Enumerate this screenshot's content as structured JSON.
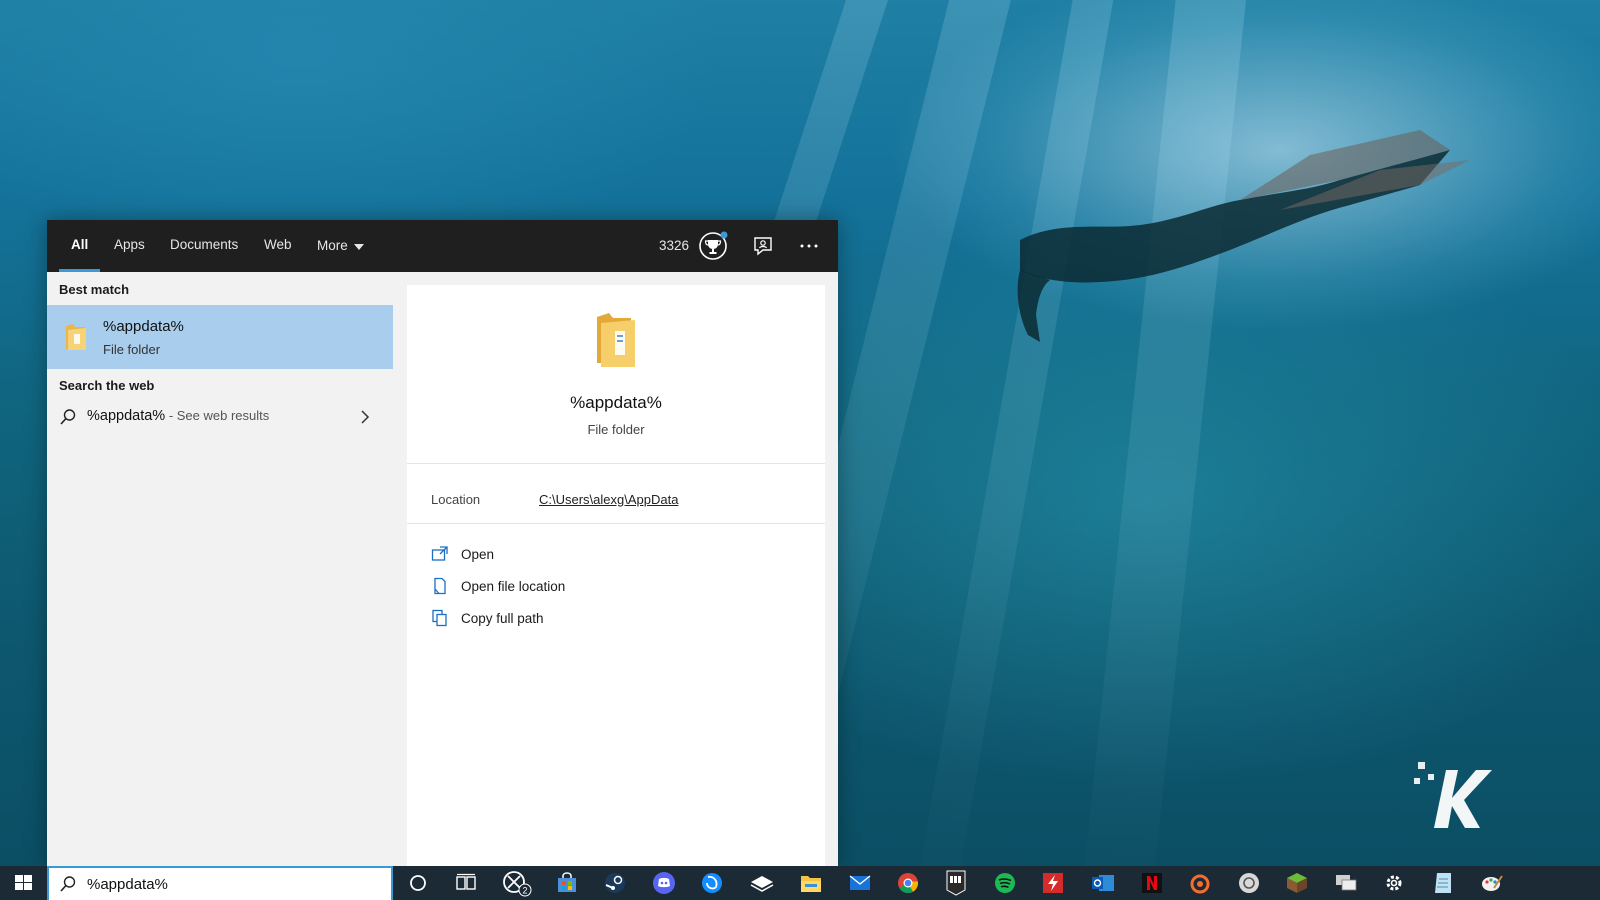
{
  "tabs": [
    {
      "label": "All",
      "active": true
    },
    {
      "label": "Apps"
    },
    {
      "label": "Documents"
    },
    {
      "label": "Web"
    },
    {
      "label": "More"
    }
  ],
  "header": {
    "points": "3326",
    "rewards_icon": "trophy-icon",
    "feedback_icon": "feedback-icon",
    "more_icon": "ellipsis-icon"
  },
  "left": {
    "best_match_title": "Best match",
    "best_match": {
      "name": "%appdata%",
      "type": "File folder",
      "icon": "folder-icon"
    },
    "search_web_title": "Search the web",
    "web_result": {
      "query": "%appdata%",
      "suffix": " - See web results",
      "icon": "search-icon"
    }
  },
  "preview": {
    "name": "%appdata%",
    "type": "File folder",
    "location_label": "Location",
    "location_value": "C:\\Users\\alexg\\AppData",
    "actions": [
      {
        "label": "Open",
        "icon": "open-icon"
      },
      {
        "label": "Open file location",
        "icon": "file-location-icon"
      },
      {
        "label": "Copy full path",
        "icon": "copy-icon"
      }
    ]
  },
  "taskbar": {
    "search_value": "%appdata%",
    "xbox_badge": "2",
    "icons": [
      "cortana-icon",
      "task-view-icon",
      "xbox-icon",
      "store-icon",
      "steam-icon",
      "discord-icon",
      "battlenet-icon",
      "gamepass-icon",
      "file-explorer-icon",
      "mail-icon",
      "chrome-icon",
      "epic-games-icon",
      "spotify-icon",
      "flash-icon",
      "outlook-icon",
      "netflix-icon",
      "origin-icon",
      "ubisoft-icon",
      "minecraft-icon",
      "network-icon",
      "settings-icon",
      "notepad-icon",
      "paint-icon"
    ]
  },
  "colors": {
    "accent": "#3a9ad9",
    "selection": "#a9cdec",
    "tabbar": "#1f1f1f",
    "taskbar": "#1c2a35"
  }
}
